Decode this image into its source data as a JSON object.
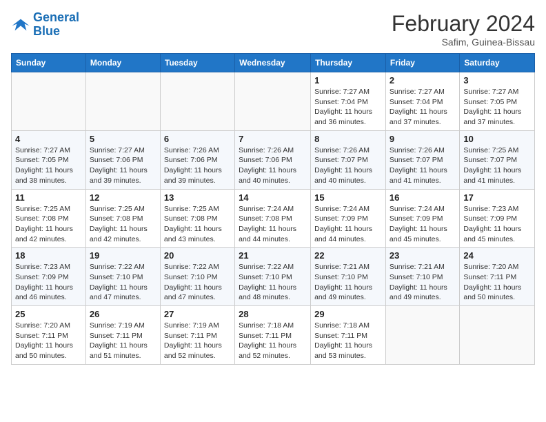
{
  "header": {
    "logo_line1": "General",
    "logo_line2": "Blue",
    "month": "February 2024",
    "location": "Safim, Guinea-Bissau"
  },
  "days_of_week": [
    "Sunday",
    "Monday",
    "Tuesday",
    "Wednesday",
    "Thursday",
    "Friday",
    "Saturday"
  ],
  "weeks": [
    [
      {
        "day": "",
        "info": ""
      },
      {
        "day": "",
        "info": ""
      },
      {
        "day": "",
        "info": ""
      },
      {
        "day": "",
        "info": ""
      },
      {
        "day": "1",
        "info": "Sunrise: 7:27 AM\nSunset: 7:04 PM\nDaylight: 11 hours\nand 36 minutes."
      },
      {
        "day": "2",
        "info": "Sunrise: 7:27 AM\nSunset: 7:04 PM\nDaylight: 11 hours\nand 37 minutes."
      },
      {
        "day": "3",
        "info": "Sunrise: 7:27 AM\nSunset: 7:05 PM\nDaylight: 11 hours\nand 37 minutes."
      }
    ],
    [
      {
        "day": "4",
        "info": "Sunrise: 7:27 AM\nSunset: 7:05 PM\nDaylight: 11 hours\nand 38 minutes."
      },
      {
        "day": "5",
        "info": "Sunrise: 7:27 AM\nSunset: 7:06 PM\nDaylight: 11 hours\nand 39 minutes."
      },
      {
        "day": "6",
        "info": "Sunrise: 7:26 AM\nSunset: 7:06 PM\nDaylight: 11 hours\nand 39 minutes."
      },
      {
        "day": "7",
        "info": "Sunrise: 7:26 AM\nSunset: 7:06 PM\nDaylight: 11 hours\nand 40 minutes."
      },
      {
        "day": "8",
        "info": "Sunrise: 7:26 AM\nSunset: 7:07 PM\nDaylight: 11 hours\nand 40 minutes."
      },
      {
        "day": "9",
        "info": "Sunrise: 7:26 AM\nSunset: 7:07 PM\nDaylight: 11 hours\nand 41 minutes."
      },
      {
        "day": "10",
        "info": "Sunrise: 7:25 AM\nSunset: 7:07 PM\nDaylight: 11 hours\nand 41 minutes."
      }
    ],
    [
      {
        "day": "11",
        "info": "Sunrise: 7:25 AM\nSunset: 7:08 PM\nDaylight: 11 hours\nand 42 minutes."
      },
      {
        "day": "12",
        "info": "Sunrise: 7:25 AM\nSunset: 7:08 PM\nDaylight: 11 hours\nand 42 minutes."
      },
      {
        "day": "13",
        "info": "Sunrise: 7:25 AM\nSunset: 7:08 PM\nDaylight: 11 hours\nand 43 minutes."
      },
      {
        "day": "14",
        "info": "Sunrise: 7:24 AM\nSunset: 7:08 PM\nDaylight: 11 hours\nand 44 minutes."
      },
      {
        "day": "15",
        "info": "Sunrise: 7:24 AM\nSunset: 7:09 PM\nDaylight: 11 hours\nand 44 minutes."
      },
      {
        "day": "16",
        "info": "Sunrise: 7:24 AM\nSunset: 7:09 PM\nDaylight: 11 hours\nand 45 minutes."
      },
      {
        "day": "17",
        "info": "Sunrise: 7:23 AM\nSunset: 7:09 PM\nDaylight: 11 hours\nand 45 minutes."
      }
    ],
    [
      {
        "day": "18",
        "info": "Sunrise: 7:23 AM\nSunset: 7:09 PM\nDaylight: 11 hours\nand 46 minutes."
      },
      {
        "day": "19",
        "info": "Sunrise: 7:22 AM\nSunset: 7:10 PM\nDaylight: 11 hours\nand 47 minutes."
      },
      {
        "day": "20",
        "info": "Sunrise: 7:22 AM\nSunset: 7:10 PM\nDaylight: 11 hours\nand 47 minutes."
      },
      {
        "day": "21",
        "info": "Sunrise: 7:22 AM\nSunset: 7:10 PM\nDaylight: 11 hours\nand 48 minutes."
      },
      {
        "day": "22",
        "info": "Sunrise: 7:21 AM\nSunset: 7:10 PM\nDaylight: 11 hours\nand 49 minutes."
      },
      {
        "day": "23",
        "info": "Sunrise: 7:21 AM\nSunset: 7:10 PM\nDaylight: 11 hours\nand 49 minutes."
      },
      {
        "day": "24",
        "info": "Sunrise: 7:20 AM\nSunset: 7:11 PM\nDaylight: 11 hours\nand 50 minutes."
      }
    ],
    [
      {
        "day": "25",
        "info": "Sunrise: 7:20 AM\nSunset: 7:11 PM\nDaylight: 11 hours\nand 50 minutes."
      },
      {
        "day": "26",
        "info": "Sunrise: 7:19 AM\nSunset: 7:11 PM\nDaylight: 11 hours\nand 51 minutes."
      },
      {
        "day": "27",
        "info": "Sunrise: 7:19 AM\nSunset: 7:11 PM\nDaylight: 11 hours\nand 52 minutes."
      },
      {
        "day": "28",
        "info": "Sunrise: 7:18 AM\nSunset: 7:11 PM\nDaylight: 11 hours\nand 52 minutes."
      },
      {
        "day": "29",
        "info": "Sunrise: 7:18 AM\nSunset: 7:11 PM\nDaylight: 11 hours\nand 53 minutes."
      },
      {
        "day": "",
        "info": ""
      },
      {
        "day": "",
        "info": ""
      }
    ]
  ]
}
